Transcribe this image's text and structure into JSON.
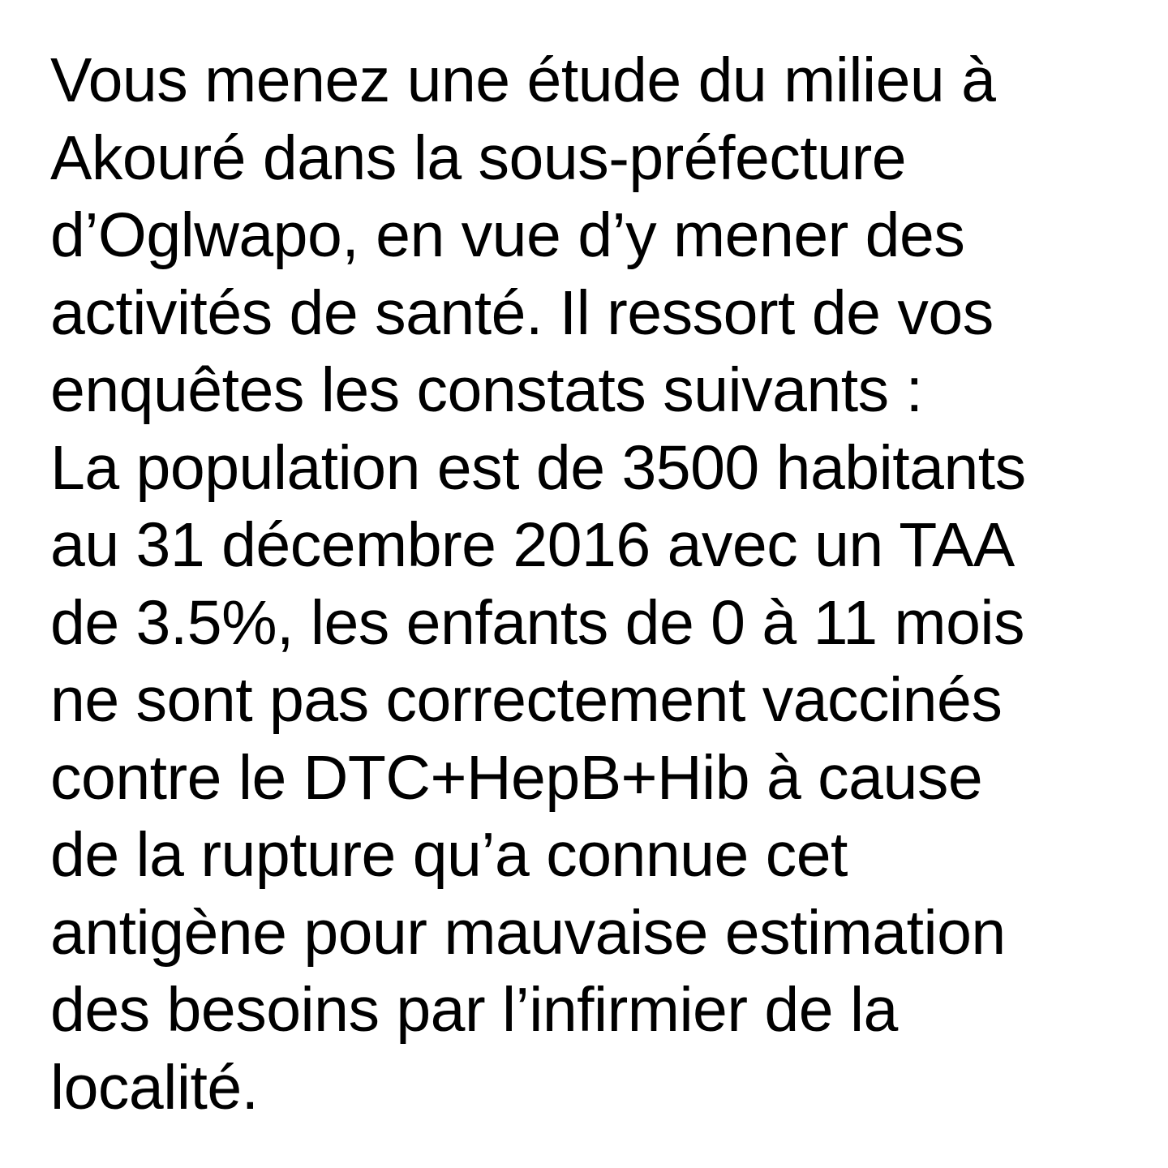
{
  "text": {
    "lines": [
      "Vous menez une étude du milieu à",
      "Akouré dans la sous-préfecture",
      "d’Oglwapo, en vue d’y mener des",
      "activités de santé. Il ressort de vos",
      "enquêtes les constats suivants :",
      "La population est de 3500 habitants",
      "au 31 décembre 2016 avec un TAA",
      "de 3.5%, les enfants de 0 à 11 mois",
      "ne sont pas correctement vaccinés",
      "contre le DTC+HepB+Hib à cause",
      "de la rupture qu’a connue cet",
      "antigène pour mauvaise estimation",
      "des besoins par l’infirmier de la",
      "localité."
    ]
  }
}
